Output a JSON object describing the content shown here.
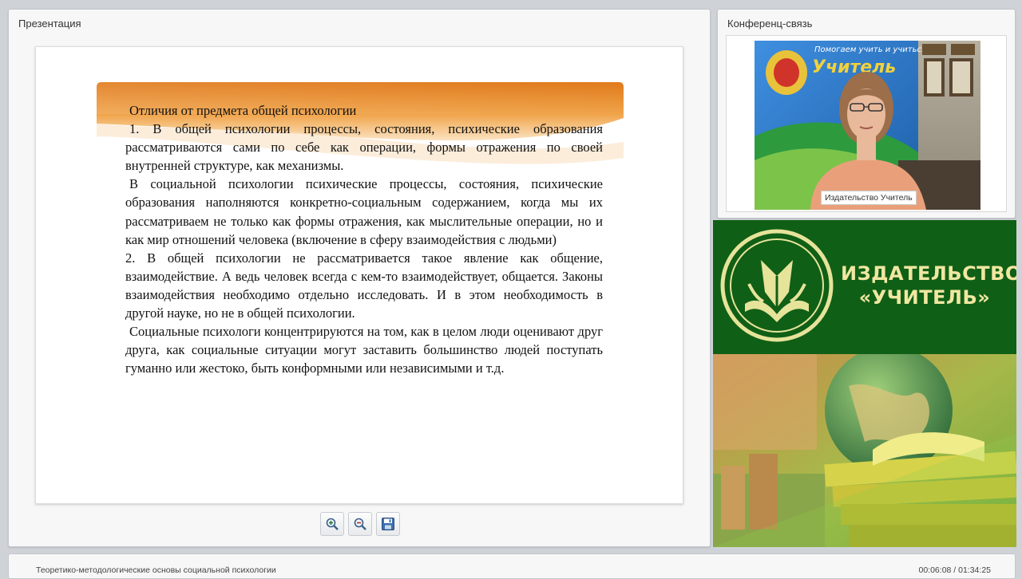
{
  "presentation": {
    "title": "Презентация",
    "slide": {
      "heading": "Отличия от предмета общей психологии",
      "paragraphs": [
        "1. В общей психологии процессы, состояния, психические образования рассматриваются сами по себе как операции, формы отражения по своей внутренней структуре, как механизмы.",
        "В социальной психологии психические процессы, состояния, психические образования наполняются конкретно-социальным содержанием, когда мы их рассматриваем не только как формы отражения, как мыслительные операции, но и как мир отношений человека (включение в сферу взаимодействия с людьми)",
        "2. В общей психологии не рассматривается такое явление как общение, взаимодействие. А ведь человек всегда с кем-то взаимодействует, общается. Законы взаимодействия необходимо отдельно исследовать. И в этом необходимость в другой науке, но не в общей психологии.",
        "Социальные психологи концентрируются на том, как в целом люди оценивают друг друга, как социальные ситуации могут заставить большинство людей поступать гуманно или жестоко, быть конформными или независимыми и т.д."
      ]
    },
    "toolbar": {
      "zoom_in_icon": "zoom-in-icon",
      "zoom_out_icon": "zoom-out-icon",
      "save_icon": "save-icon"
    }
  },
  "conference": {
    "title": "Конференц-связь",
    "speaker_label": "Издательство Учитель",
    "banner_text": {
      "slogan": "Помогаем учить и учиться",
      "brand": "Учитель"
    }
  },
  "promo": {
    "publisher_line1": "ИЗДАТЕЛЬСТВО",
    "publisher_line2": "«УЧИТЕЛЬ»"
  },
  "footer": {
    "title": "Теоретико-методологические основы социальной психологии",
    "time": "00:06:08 / 01:34:25"
  },
  "colors": {
    "banner_orange": "#e9902a",
    "promo_green": "#105f16",
    "publisher_text": "#f0e7a1"
  }
}
